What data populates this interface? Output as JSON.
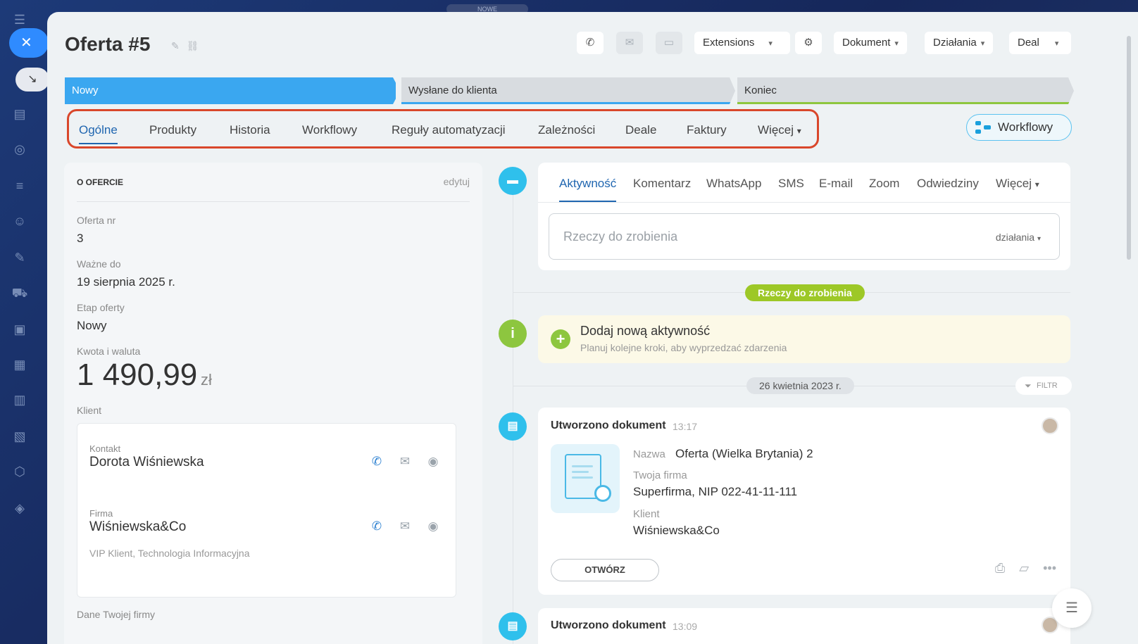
{
  "app": {
    "badge_new": "NOWE"
  },
  "header": {
    "title": "Oferta #5",
    "extensions_label": "Extensions",
    "dokument_label": "Dokument",
    "dzialania_label": "Działania",
    "deal_label": "Deal"
  },
  "stages": [
    {
      "label": "Nowy"
    },
    {
      "label": "Wysłane do klienta"
    },
    {
      "label": "Koniec"
    }
  ],
  "tabs": [
    {
      "label": "Ogólne"
    },
    {
      "label": "Produkty"
    },
    {
      "label": "Historia"
    },
    {
      "label": "Workflowy"
    },
    {
      "label": "Reguły automatyzacji"
    },
    {
      "label": "Zależności"
    },
    {
      "label": "Deale"
    },
    {
      "label": "Faktury"
    },
    {
      "label": "Więcej"
    }
  ],
  "workflow_button": "Workflowy",
  "about": {
    "heading": "O OFERCIE",
    "edit": "edytuj",
    "fields": [
      {
        "label": "Oferta nr",
        "value": "3"
      },
      {
        "label": "Ważne do",
        "value": "19 sierpnia 2025 r."
      },
      {
        "label": "Etap oferty",
        "value": "Nowy"
      },
      {
        "label": "Kwota i waluta",
        "value": ""
      }
    ],
    "amount": "1 490,99",
    "currency": "zł",
    "client_label": "Klient",
    "contact_label": "Kontakt",
    "contact_name": "Dorota Wiśniewska",
    "company_label": "Firma",
    "company_name": "Wiśniewska&Co",
    "company_tags": "VIP Klient, Technologia Informacyjna",
    "own_company_label": "Dane Twojej firmy"
  },
  "activity": {
    "tabs": [
      {
        "label": "Aktywność"
      },
      {
        "label": "Komentarz"
      },
      {
        "label": "WhatsApp"
      },
      {
        "label": "SMS"
      },
      {
        "label": "E-mail"
      },
      {
        "label": "Zoom"
      },
      {
        "label": "Odwiedziny"
      },
      {
        "label": "Więcej"
      }
    ],
    "todo_placeholder": "Rzeczy do zrobienia",
    "todo_actions": "działania"
  },
  "timeline": {
    "todo_pill": "Rzeczy do zrobienia",
    "add_title": "Dodaj nową aktywność",
    "add_sub": "Planuj kolejne kroki, aby wyprzedzać zdarzenia",
    "date": "26 kwietnia 2023 r.",
    "filter": "FILTR",
    "doc": {
      "title": "Utworzono dokument",
      "time": "13:17",
      "name_label": "Nazwa",
      "name_value": "Oferta (Wielka Brytania) 2",
      "company_label": "Twoja firma",
      "company_value": "Superfirma, NIP 022-41-11-111",
      "client_label": "Klient",
      "client_value": "Wiśniewska&Co",
      "open_button": "OTWÓRZ"
    },
    "doc2": {
      "title": "Utworzono dokument",
      "time": "13:09"
    }
  },
  "colors": {
    "accent": "#2066b0",
    "stage_active": "#3aa7f0",
    "highlight": "#d9472b",
    "success": "#9dc827"
  }
}
